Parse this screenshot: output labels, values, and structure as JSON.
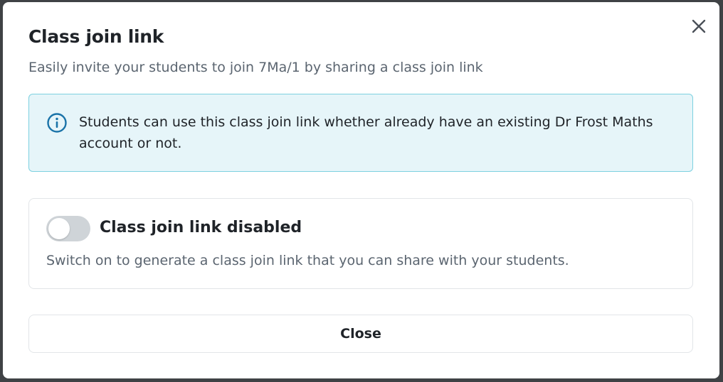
{
  "modal": {
    "title": "Class join link",
    "subtitle": "Easily invite your students to join 7Ma/1 by sharing a class join link",
    "close_icon": "close-x-icon"
  },
  "info": {
    "icon": "info-circle-icon",
    "text": "Students can use this class join link whether already have an existing Dr Frost Maths account or not.",
    "accent_color": "#1a73a8",
    "background_color": "#e6f5f9"
  },
  "toggle": {
    "label": "Class join link disabled",
    "description": "Switch on to generate a class join link that you can share with your students.",
    "enabled": false
  },
  "footer": {
    "close_label": "Close"
  }
}
